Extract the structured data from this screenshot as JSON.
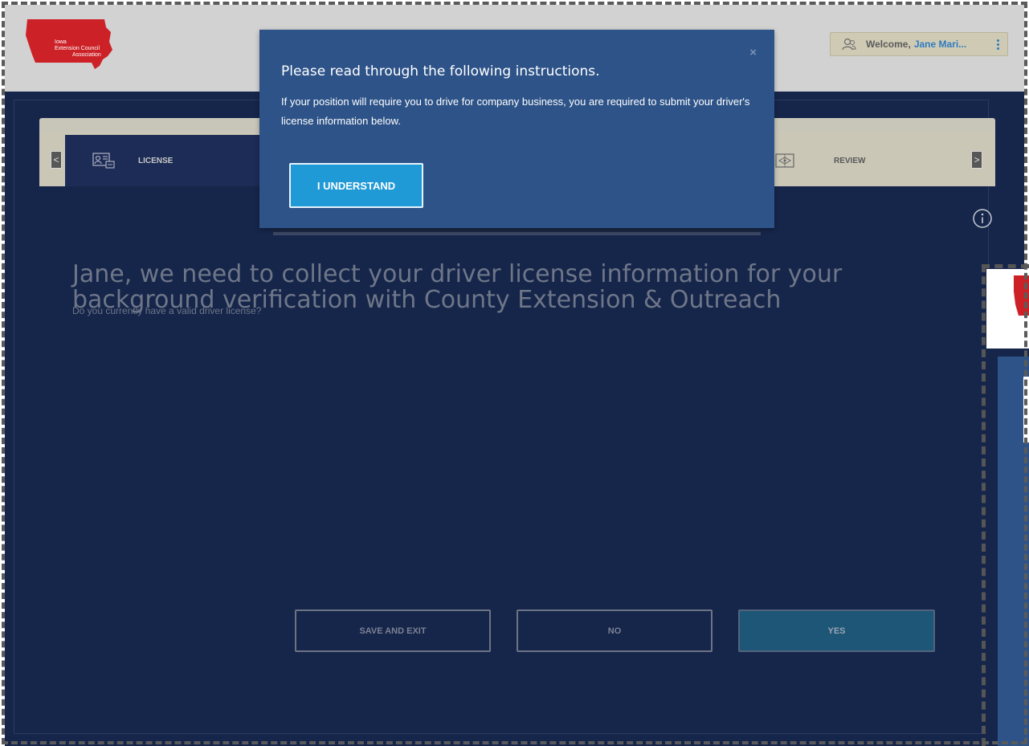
{
  "header": {
    "logo": {
      "line1": "Iowa",
      "line2": "Extension Council",
      "line3": "Association",
      "color": "#cc2127"
    },
    "welcome_prefix": "Welcome,",
    "welcome_name": "Jane Mari..."
  },
  "stepper": {
    "active_step_label": "LICENSE",
    "review_step_label": "REVIEW",
    "prev_arrow": "<",
    "next_arrow": ">"
  },
  "content": {
    "heading": "Jane, we need to collect your driver license information for your background verification with County Extension & Outreach",
    "question": "Do you currently have a valid driver license?",
    "buttons": {
      "save": "SAVE AND EXIT",
      "no": "NO",
      "yes": "YES"
    }
  },
  "modal": {
    "close": "×",
    "title": "Please read through the following instructions.",
    "body": "If your position will require you to drive for company business, you are required to submit your driver's license information below.",
    "confirm": "I UNDERSTAND"
  },
  "colors": {
    "page_bg": "#16254a",
    "modal_bg": "#2d5388",
    "primary_button": "#1f9ad6",
    "yes_button": "#1d5676",
    "link": "#2f7cc0"
  },
  "icons": [
    "iowa-logo",
    "user-icon",
    "kebab-menu-icon",
    "license-card-icon",
    "review-icon",
    "info-icon",
    "close-icon",
    "chevron-left-icon",
    "chevron-right-icon"
  ]
}
